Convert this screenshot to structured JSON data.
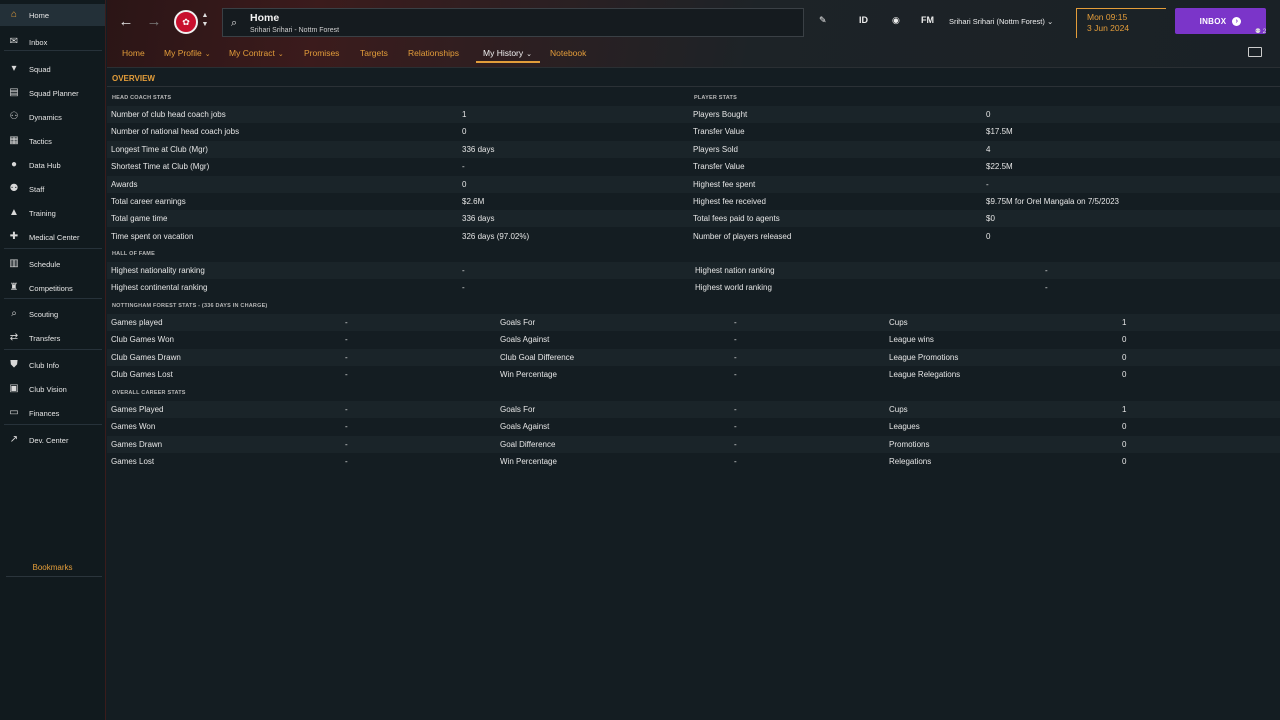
{
  "sidebar": {
    "items": [
      {
        "label": "Home",
        "icon": "home-icon",
        "glyph": "⌂"
      },
      {
        "label": "Inbox",
        "icon": "inbox-icon",
        "glyph": "✉",
        "badge": "74"
      },
      {
        "label": "Squad",
        "icon": "shirt-icon",
        "glyph": "▾"
      },
      {
        "label": "Squad Planner",
        "icon": "clipboard-icon",
        "glyph": "▤"
      },
      {
        "label": "Dynamics",
        "icon": "dynamics-icon",
        "glyph": "⚇"
      },
      {
        "label": "Tactics",
        "icon": "tactics-board-icon",
        "glyph": "▦"
      },
      {
        "label": "Data Hub",
        "icon": "data-hub-icon",
        "glyph": "●"
      },
      {
        "label": "Staff",
        "icon": "staff-icon",
        "glyph": "⚉"
      },
      {
        "label": "Training",
        "icon": "training-cone-icon",
        "glyph": "▲"
      },
      {
        "label": "Medical Center",
        "icon": "medical-icon",
        "glyph": "✚"
      },
      {
        "label": "Schedule",
        "icon": "calendar-icon",
        "glyph": "▥"
      },
      {
        "label": "Competitions",
        "icon": "trophy-icon",
        "glyph": "♜"
      },
      {
        "label": "Scouting",
        "icon": "magnifier-icon",
        "glyph": "⌕"
      },
      {
        "label": "Transfers",
        "icon": "transfer-arrows-icon",
        "glyph": "⇄"
      },
      {
        "label": "Club Info",
        "icon": "shield-icon",
        "glyph": "⛊"
      },
      {
        "label": "Club Vision",
        "icon": "briefcase-icon",
        "glyph": "▣"
      },
      {
        "label": "Finances",
        "icon": "money-icon",
        "glyph": "▭"
      },
      {
        "label": "Dev. Center",
        "icon": "growth-icon",
        "glyph": "↗"
      }
    ],
    "bookmarks_label": "Bookmarks"
  },
  "header": {
    "search_title": "Home",
    "search_subtitle": "Srihari Srihari - Nottm Forest",
    "id_label": "ID",
    "fm_label": "FM",
    "manager_label": "Srihari Srihari (Nottm Forest)",
    "date_line1": "Mon 09:15",
    "date_line2": "3 Jun 2024",
    "inbox_label": "INBOX",
    "inbox_count": "2"
  },
  "tabs": [
    {
      "label": "Home"
    },
    {
      "label": "My Profile",
      "dropdown": true
    },
    {
      "label": "My Contract",
      "dropdown": true
    },
    {
      "label": "Promises"
    },
    {
      "label": "Targets"
    },
    {
      "label": "Relationships"
    },
    {
      "label": "My History",
      "dropdown": true,
      "active": true
    },
    {
      "label": "Notebook"
    }
  ],
  "overview_label": "OVERVIEW",
  "sections": {
    "head_coach_title": "HEAD COACH STATS",
    "player_stats_title": "PLAYER STATS",
    "hall_of_fame_title": "HALL OF FAME",
    "club_stats_title": "NOTTINGHAM FOREST STATS - (336 DAYS IN CHARGE)",
    "career_stats_title": "OVERALL CAREER STATS"
  },
  "head_coach_rows": [
    {
      "label": "Number of club head coach jobs",
      "value": "1",
      "label2": "Players Bought",
      "value2": "0"
    },
    {
      "label": "Number of national head coach jobs",
      "value": "0",
      "label2": "Transfer Value",
      "value2": "$17.5M"
    },
    {
      "label": "Longest Time at Club (Mgr)",
      "value": "336 days",
      "label2": "Players Sold",
      "value2": "4"
    },
    {
      "label": "Shortest Time at Club (Mgr)",
      "value": "-",
      "label2": "Transfer Value",
      "value2": "$22.5M"
    },
    {
      "label": "Awards",
      "value": "0",
      "label2": "Highest fee spent",
      "value2": "-"
    },
    {
      "label": "Total career earnings",
      "value": "$2.6M",
      "label2": "Highest fee received",
      "value2": "$9.75M for Orel Mangala on 7/5/2023"
    },
    {
      "label": "Total game time",
      "value": "336 days",
      "label2": "Total fees paid to agents",
      "value2": "$0"
    },
    {
      "label": "Time spent on vacation",
      "value": "326 days (97.02%)",
      "label2": "Number of players released",
      "value2": "0"
    }
  ],
  "hall_of_fame_rows": [
    {
      "label": "Highest nationality ranking",
      "value": "-",
      "label2": "Highest nation ranking",
      "value2": "-"
    },
    {
      "label": "Highest continental ranking",
      "value": "-",
      "label2": "Highest world ranking",
      "value2": "-"
    }
  ],
  "club_rows": [
    {
      "c1": "Games played",
      "v1": "-",
      "c2": "Goals For",
      "v2": "-",
      "c3": "Cups",
      "v3": "1"
    },
    {
      "c1": "Club Games Won",
      "v1": "-",
      "c2": "Goals Against",
      "v2": "-",
      "c3": "League wins",
      "v3": "0"
    },
    {
      "c1": "Club Games Drawn",
      "v1": "-",
      "c2": "Club Goal Difference",
      "v2": "-",
      "c3": "League Promotions",
      "v3": "0"
    },
    {
      "c1": "Club Games Lost",
      "v1": "-",
      "c2": "Win Percentage",
      "v2": "-",
      "c3": "League Relegations",
      "v3": "0"
    }
  ],
  "career_rows": [
    {
      "c1": "Games Played",
      "v1": "-",
      "c2": "Goals For",
      "v2": "-",
      "c3": "Cups",
      "v3": "1"
    },
    {
      "c1": "Games Won",
      "v1": "-",
      "c2": "Goals Against",
      "v2": "-",
      "c3": "Leagues",
      "v3": "0"
    },
    {
      "c1": "Games Drawn",
      "v1": "-",
      "c2": "Goal Difference",
      "v2": "-",
      "c3": "Promotions",
      "v3": "0"
    },
    {
      "c1": "Games Lost",
      "v1": "-",
      "c2": "Win Percentage",
      "v2": "-",
      "c3": "Relegations",
      "v3": "0"
    }
  ],
  "colors": {
    "accent": "#e39d3a",
    "inbox": "#7b35c9",
    "club": "#c8102e"
  }
}
